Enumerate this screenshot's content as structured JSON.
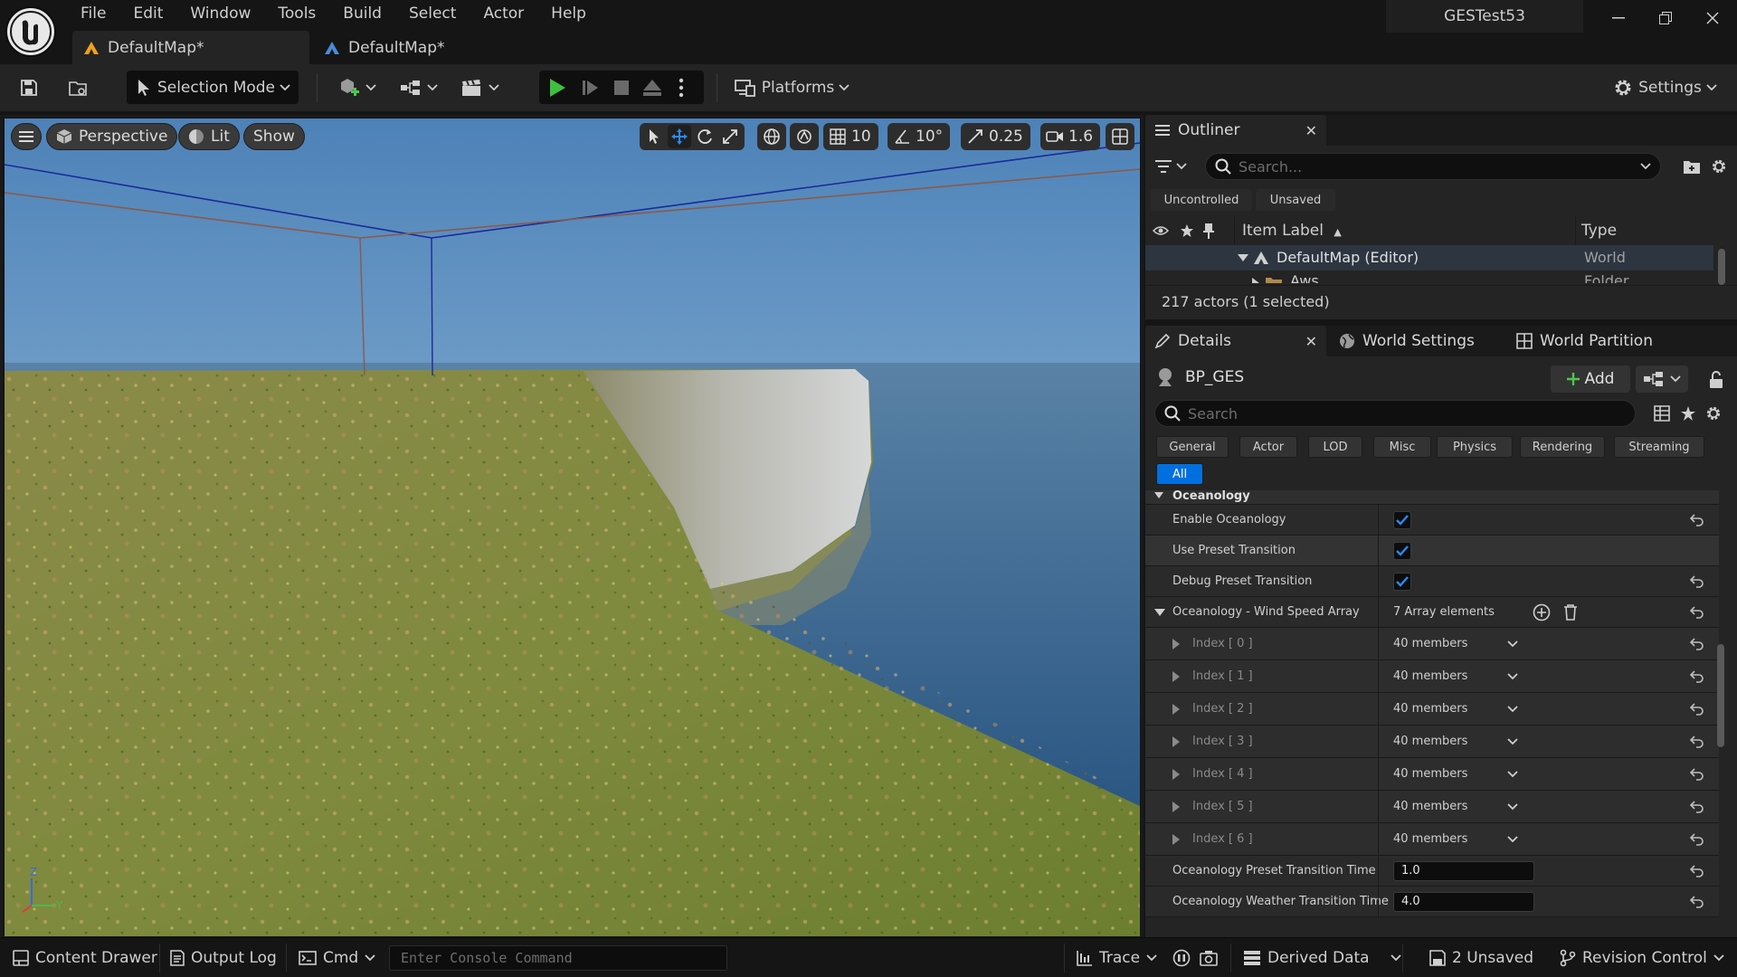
{
  "menu": [
    "File",
    "Edit",
    "Window",
    "Tools",
    "Build",
    "Select",
    "Actor",
    "Help"
  ],
  "project_name": "GESTest53",
  "tabs": [
    {
      "label": "DefaultMap*"
    },
    {
      "label": "DefaultMap*"
    }
  ],
  "toolbar": {
    "selection_mode": "Selection Mode",
    "platforms": "Platforms",
    "settings": "Settings"
  },
  "viewport": {
    "perspective": "Perspective",
    "lit": "Lit",
    "show": "Show",
    "grid_snap": "10",
    "rotation_snap": "10°",
    "scale_snap": "0.25",
    "camera_speed": "1.6",
    "axis_z": "Z",
    "axis_y": "Y"
  },
  "outliner": {
    "tab_label": "Outliner",
    "search_placeholder": "Search...",
    "filter_uncontrolled": "Uncontrolled",
    "filter_unsaved": "Unsaved",
    "col_item_label": "Item Label",
    "col_type": "Type",
    "rows": [
      {
        "label": "DefaultMap (Editor)",
        "type": "World"
      },
      {
        "label": "Aws",
        "type": "Folder"
      }
    ],
    "actor_count": "217 actors (1 selected)"
  },
  "details": {
    "tabs": [
      "Details",
      "World Settings",
      "World Partition"
    ],
    "actor_name": "BP_GES",
    "add_label": "Add",
    "search_placeholder": "Search",
    "filters": [
      "General",
      "Actor",
      "LOD",
      "Misc",
      "Physics",
      "Rendering",
      "Streaming",
      "All"
    ],
    "section": "Oceanology",
    "props": [
      {
        "name": "Enable Oceanology",
        "checked": true
      },
      {
        "name": "Use Preset Transition",
        "checked": true
      },
      {
        "name": "Debug Preset Transition",
        "checked": true
      }
    ],
    "array": {
      "name": "Oceanology - Wind Speed Array",
      "value": "7 Array elements"
    },
    "indices": [
      {
        "name": "Index [ 0 ]",
        "value": "40 members"
      },
      {
        "name": "Index [ 1 ]",
        "value": "40 members"
      },
      {
        "name": "Index [ 2 ]",
        "value": "40 members"
      },
      {
        "name": "Index [ 3 ]",
        "value": "40 members"
      },
      {
        "name": "Index [ 4 ]",
        "value": "40 members"
      },
      {
        "name": "Index [ 5 ]",
        "value": "40 members"
      },
      {
        "name": "Index [ 6 ]",
        "value": "40 members"
      }
    ],
    "preset_time": {
      "name": "Oceanology Preset Transition Time",
      "value": "1.0"
    },
    "weather_time": {
      "name": "Oceanology Weather Transition Time",
      "value": "4.0"
    }
  },
  "statusbar": {
    "content_drawer": "Content Drawer",
    "output_log": "Output Log",
    "cmd": "Cmd",
    "console_placeholder": "Enter Console Command",
    "trace": "Trace",
    "derived_data": "Derived Data",
    "unsaved": "2 Unsaved",
    "revision_control": "Revision Control"
  },
  "colors": {
    "accent_blue": "#0070e0",
    "play_green": "#3fbf3f",
    "panel_bg": "#1a1a1a",
    "toolbar_bg": "#242424"
  }
}
